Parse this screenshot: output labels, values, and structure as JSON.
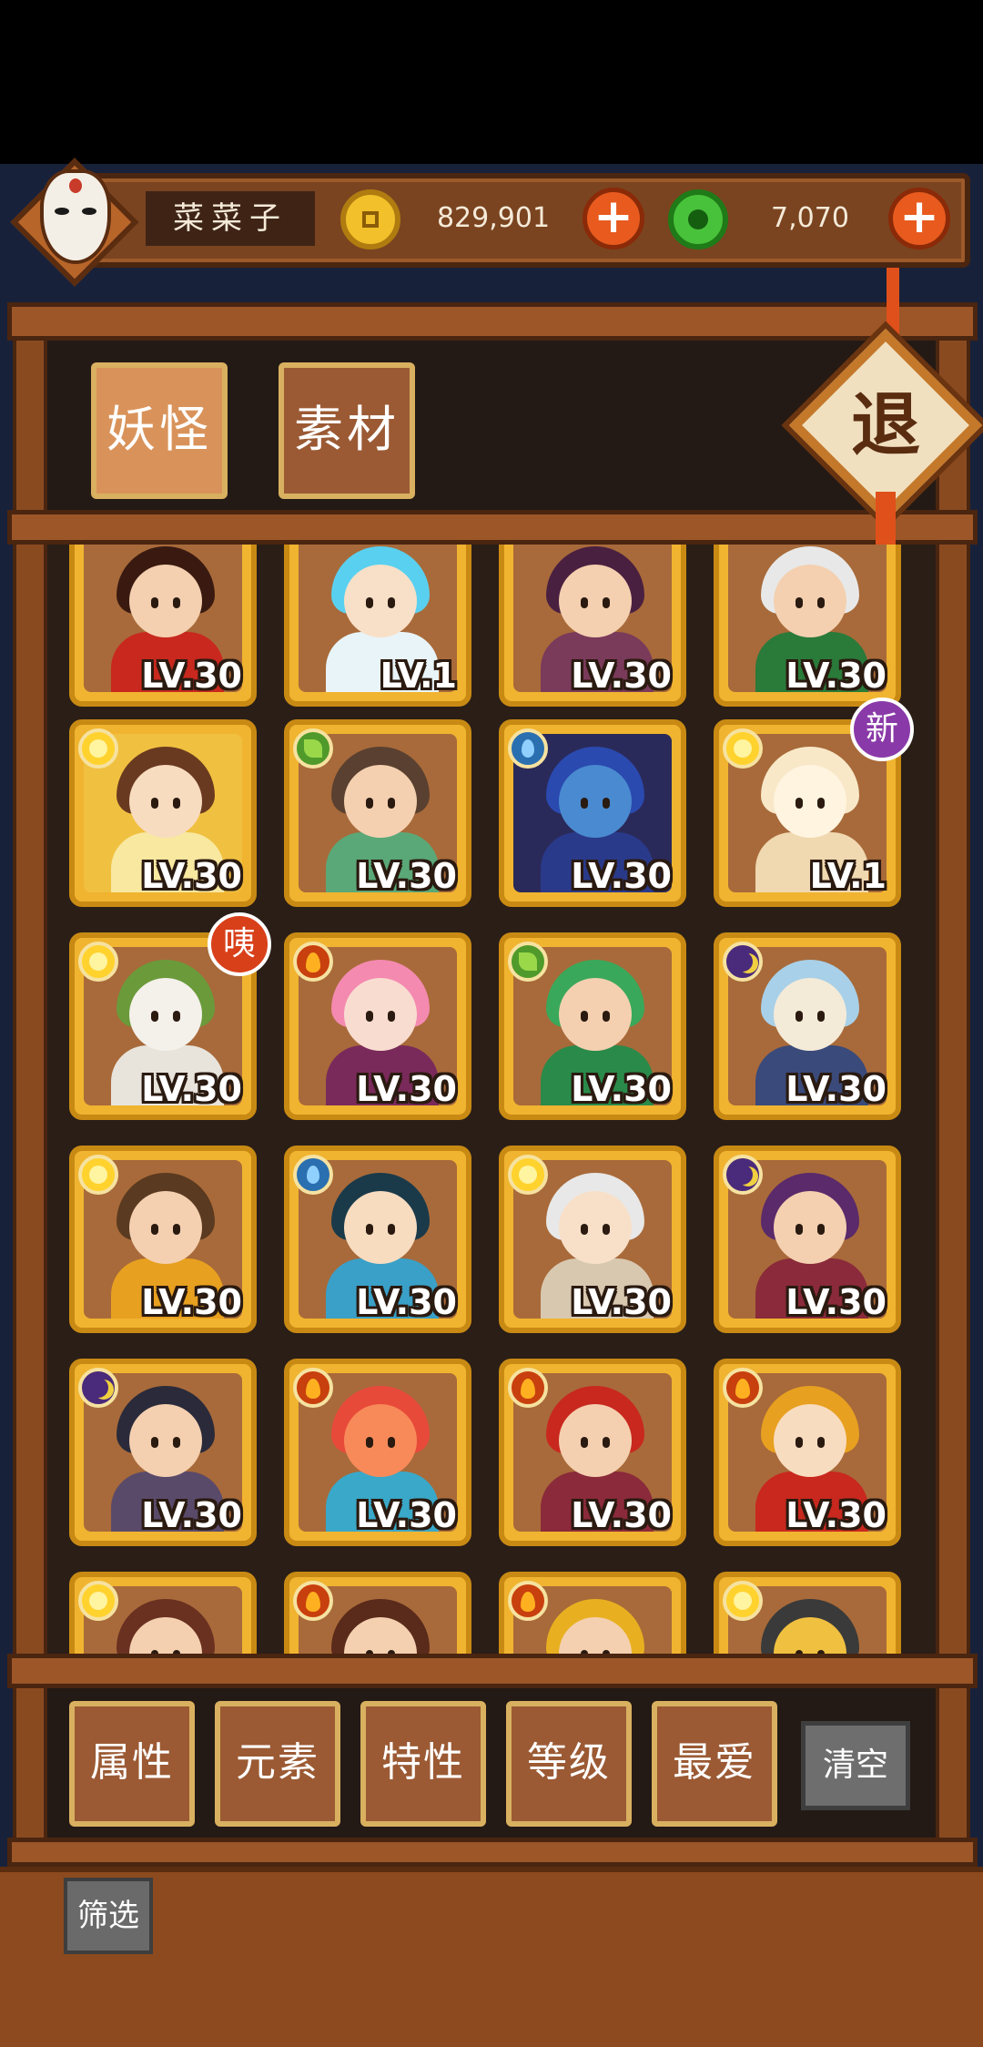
{
  "header": {
    "player_name": "菜菜子",
    "gold_amount": "829,901",
    "jade_amount": "7,070",
    "plus_label": "+"
  },
  "tabs": {
    "yokai": "妖怪",
    "material": "素材"
  },
  "exit_label": "退",
  "badges": {
    "new": "新",
    "ho": "咦"
  },
  "cards": [
    {
      "level": "LV.30",
      "element": "none",
      "hair": "#3a1a10",
      "skin": "#f4d0b0",
      "outfit": "#c8281e",
      "bg": "#a86a3a"
    },
    {
      "level": "LV.1",
      "element": "none",
      "hair": "#5ad0f0",
      "skin": "#f8e0c8",
      "outfit": "#e8f4f8",
      "bg": "#a86a3a"
    },
    {
      "level": "LV.30",
      "element": "none",
      "hair": "#4a2040",
      "skin": "#f4d0b0",
      "outfit": "#7a3a5a",
      "bg": "#a86a3a"
    },
    {
      "level": "LV.30",
      "element": "none",
      "hair": "#e8e8e8",
      "skin": "#f4d0b0",
      "outfit": "#2a7a3a",
      "bg": "#a86a3a"
    },
    {
      "level": "LV.30",
      "element": "sun",
      "hair": "#6a3a20",
      "skin": "#f8dcc0",
      "outfit": "#f8e8a0",
      "bg": "#f0c040"
    },
    {
      "level": "LV.30",
      "element": "leaf",
      "hair": "#5a4030",
      "skin": "#f4d0b0",
      "outfit": "#5aa878",
      "bg": "#a86a3a"
    },
    {
      "level": "LV.30",
      "element": "water",
      "hair": "#2a4ab0",
      "skin": "#4a8ad0",
      "outfit": "#2a3a8a",
      "bg": "#2a2a5a"
    },
    {
      "level": "LV.1",
      "element": "sun",
      "hair": "#f8e8c8",
      "skin": "#fff4e0",
      "outfit": "#f0d8b0",
      "bg": "#a86a3a"
    },
    {
      "level": "LV.30",
      "element": "sun",
      "hair": "#6a9a3a",
      "skin": "#f4f0ea",
      "outfit": "#e8e4dc",
      "bg": "#a86a3a"
    },
    {
      "level": "LV.30",
      "element": "fire",
      "hair": "#f48ab0",
      "skin": "#f8dcd0",
      "outfit": "#7a2a5a",
      "bg": "#a86a3a"
    },
    {
      "level": "LV.30",
      "element": "leaf",
      "hair": "#3aa85a",
      "skin": "#f4d0b0",
      "outfit": "#2a8a4a",
      "bg": "#a86a3a"
    },
    {
      "level": "LV.30",
      "element": "moon",
      "hair": "#a8d0e8",
      "skin": "#f4ead8",
      "outfit": "#3a4a7a",
      "bg": "#a86a3a"
    },
    {
      "level": "LV.30",
      "element": "sun",
      "hair": "#5a3a20",
      "skin": "#f4d0b0",
      "outfit": "#e8a020",
      "bg": "#a86a3a"
    },
    {
      "level": "LV.30",
      "element": "water",
      "hair": "#1a3a4a",
      "skin": "#f8dcc0",
      "outfit": "#3aa0c8",
      "bg": "#a86a3a"
    },
    {
      "level": "LV.30",
      "element": "sun",
      "hair": "#e8e8e8",
      "skin": "#f8e0c8",
      "outfit": "#d8c8b0",
      "bg": "#a86a3a"
    },
    {
      "level": "LV.30",
      "element": "moon",
      "hair": "#5a2a6a",
      "skin": "#f4d0b0",
      "outfit": "#8a2a3a",
      "bg": "#a86a3a"
    },
    {
      "level": "LV.30",
      "element": "moon",
      "hair": "#2a2a3a",
      "skin": "#f4d0b0",
      "outfit": "#5a4a6a",
      "bg": "#a86a3a"
    },
    {
      "level": "LV.30",
      "element": "fire",
      "hair": "#e84a3a",
      "skin": "#f88a5a",
      "outfit": "#3aa8c8",
      "bg": "#a86a3a"
    },
    {
      "level": "LV.30",
      "element": "fire",
      "hair": "#c8281e",
      "skin": "#f4d0b0",
      "outfit": "#8a2a3a",
      "bg": "#a86a3a"
    },
    {
      "level": "LV.30",
      "element": "fire",
      "hair": "#e8a020",
      "skin": "#f8dcc0",
      "outfit": "#c8281e",
      "bg": "#a86a3a"
    },
    {
      "level": "",
      "element": "sun",
      "hair": "#6a3020",
      "skin": "#f4d0b0",
      "outfit": "#a83a2a",
      "bg": "#a86a3a"
    },
    {
      "level": "",
      "element": "fire",
      "hair": "#5a2a1a",
      "skin": "#f4d0b0",
      "outfit": "#c8281e",
      "bg": "#a86a3a"
    },
    {
      "level": "",
      "element": "fire",
      "hair": "#e8b020",
      "skin": "#f4d0b0",
      "outfit": "#3a2a1a",
      "bg": "#a86a3a"
    },
    {
      "level": "",
      "element": "sun",
      "hair": "#3a3a3a",
      "skin": "#f0c040",
      "outfit": "#d8a020",
      "bg": "#a86a3a"
    }
  ],
  "filters": [
    "属性",
    "元素",
    "特性",
    "等级",
    "最爱"
  ],
  "clear_label": "清空",
  "filter_label": "筛选"
}
